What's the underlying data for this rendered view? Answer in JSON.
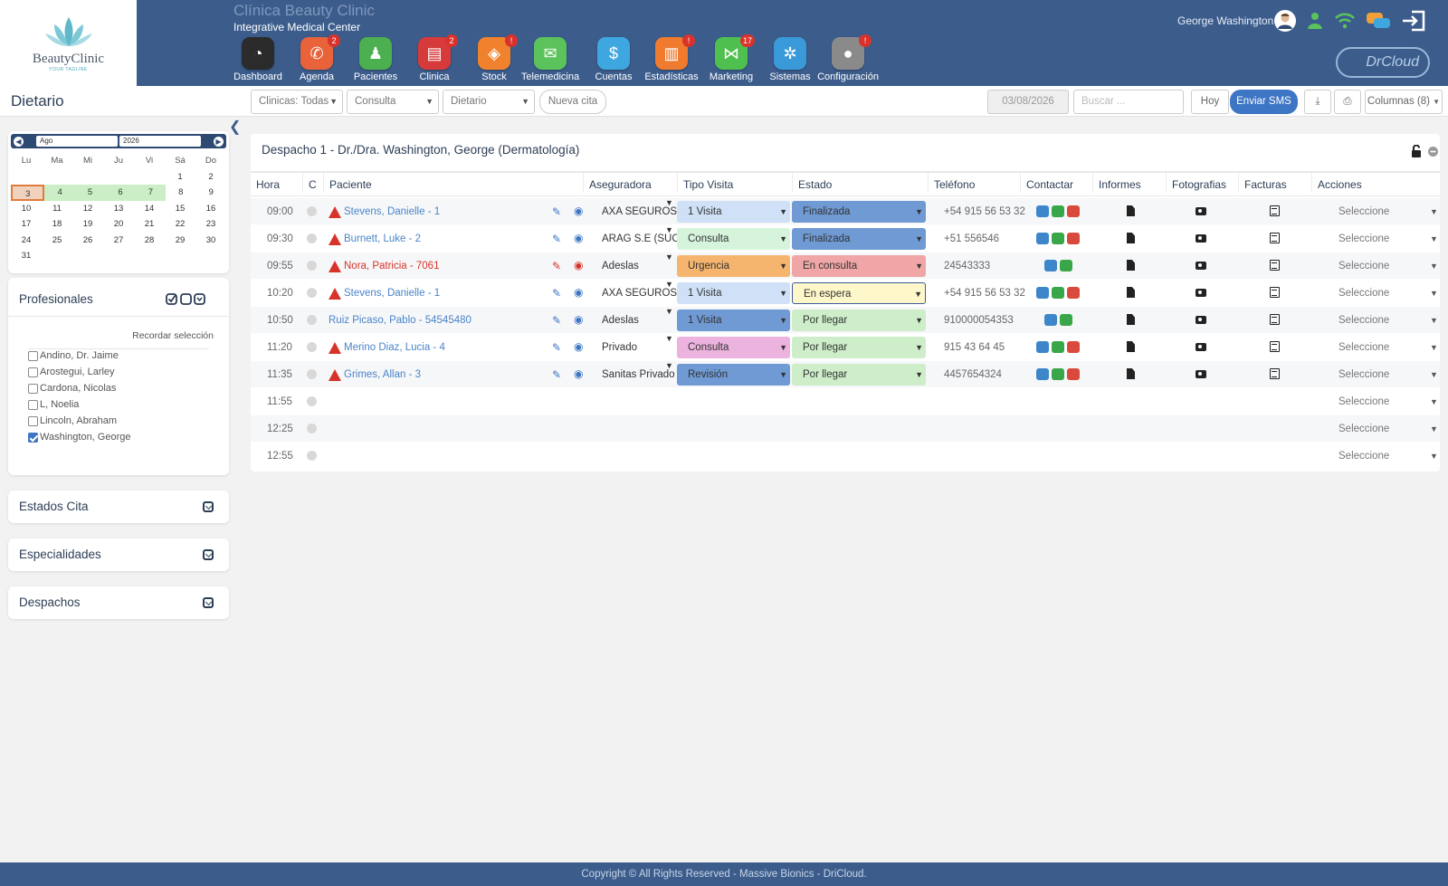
{
  "brand": {
    "logo_name": "BeautyClinic",
    "logo_tagline": "YOUR TAGLINE",
    "clinic_title": "Clínica Beauty Clinic",
    "clinic_subtitle": "Integrative Medical Center",
    "cloud_logo": "DrCloud"
  },
  "modules": [
    {
      "label": "Dashboard",
      "icon": "speedometer-icon",
      "color": "#2b2b2b",
      "badge": ""
    },
    {
      "label": "Agenda",
      "icon": "phone-icon",
      "color": "#e8623a",
      "badge": "2"
    },
    {
      "label": "Pacientes",
      "icon": "person-icon",
      "color": "#4caf50",
      "badge": ""
    },
    {
      "label": "Clinica",
      "icon": "clipboard-icon",
      "color": "#d63a3a",
      "badge": "2"
    },
    {
      "label": "Stock",
      "icon": "box-icon",
      "color": "#f0822e",
      "badge": "!"
    },
    {
      "label": "Telemedicina",
      "icon": "chat-icon",
      "color": "#5cc35c",
      "badge": ""
    },
    {
      "label": "Cuentas",
      "icon": "money-icon",
      "color": "#3fa7e0",
      "badge": ""
    },
    {
      "label": "Estadísticas",
      "icon": "chart-icon",
      "color": "#f07a2e",
      "badge": "!"
    },
    {
      "label": "Marketing",
      "icon": "share-icon",
      "color": "#4fbf4f",
      "badge": "17"
    },
    {
      "label": "Sistemas",
      "icon": "gear-icon",
      "color": "#3a9ad9",
      "badge": ""
    },
    {
      "label": "Configuración",
      "icon": "settings-icon",
      "color": "#8a8a8a",
      "badge": "!"
    }
  ],
  "user": {
    "name": "George Washington"
  },
  "toolbar": {
    "page_title": "Dietario",
    "clinicas": "Clinicas: Todas",
    "consulta": "Consulta",
    "dietario": "Dietario",
    "nueva_cita": "Nueva cita",
    "date_value": "03/08/2026",
    "search_placeholder": "Buscar ...",
    "hoy": "Hoy",
    "enviar_sms": "Enviar SMS",
    "columnas": "Columnas (8)"
  },
  "calendar": {
    "month": "Ago",
    "year": "2026",
    "weekdays": [
      "Lu",
      "Ma",
      "Mi",
      "Ju",
      "Vi",
      "Sá",
      "Do"
    ],
    "weeks": [
      [
        "",
        "",
        "",
        "",
        "",
        "1",
        "2"
      ],
      [
        "3",
        "4",
        "5",
        "6",
        "7",
        "8",
        "9"
      ],
      [
        "10",
        "11",
        "12",
        "13",
        "14",
        "15",
        "16"
      ],
      [
        "17",
        "18",
        "19",
        "20",
        "21",
        "22",
        "23"
      ],
      [
        "24",
        "25",
        "26",
        "27",
        "28",
        "29",
        "30"
      ],
      [
        "31",
        "",
        "",
        "",
        "",
        "",
        ""
      ]
    ],
    "today": "3",
    "highlighted": [
      "4",
      "5",
      "6",
      "7"
    ]
  },
  "profesionales": {
    "title": "Profesionales",
    "remember": "Recordar selección",
    "items": [
      {
        "label": "Andino, Dr. Jaime",
        "checked": false
      },
      {
        "label": "Arostegui, Larley",
        "checked": false
      },
      {
        "label": "Cardona, Nicolas",
        "checked": false
      },
      {
        "label": "L, Noelia",
        "checked": false
      },
      {
        "label": "Lincoln, Abraham",
        "checked": false
      },
      {
        "label": "Washington, George",
        "checked": true
      }
    ]
  },
  "panels": {
    "estados": "Estados Cita",
    "especialidades": "Especialidades",
    "despachos": "Despachos"
  },
  "agenda": {
    "title": "Despacho 1 - Dr./Dra. Washington, George (Dermatología)",
    "columns": [
      "Hora",
      "C",
      "Paciente",
      "Aseguradora",
      "Tipo Visita",
      "Estado",
      "Teléfono",
      "Contactar",
      "Informes",
      "Fotografias",
      "Facturas",
      "Acciones"
    ],
    "rows": [
      {
        "hora": "09:00",
        "paciente": "Stevens, Danielle - 1",
        "warn": true,
        "red": false,
        "aseguradora": "AXA SEGUROS G",
        "tipo": "1 Visita",
        "tipo_color": "#cfe0f7",
        "estado": "Finalizada",
        "estado_color": "#6f9ad4",
        "telefono": "+54 915 56 53 32",
        "email": true,
        "accion": "Seleccione"
      },
      {
        "hora": "09:30",
        "paciente": "Burnett, Luke - 2",
        "warn": true,
        "red": false,
        "aseguradora": "ARAG S.E (SUCU",
        "tipo": "Consulta",
        "tipo_color": "#d6f3dc",
        "estado": "Finalizada",
        "estado_color": "#6f9ad4",
        "telefono": "+51 556546",
        "email": true,
        "accion": "Seleccione"
      },
      {
        "hora": "09:55",
        "paciente": "Nora, Patricia - 7061",
        "warn": true,
        "red": true,
        "aseguradora": "Adeslas",
        "tipo": "Urgencia",
        "tipo_color": "#f5b56e",
        "estado": "En consulta",
        "estado_color": "#f0a6a6",
        "telefono": "24543333",
        "email": false,
        "accion": "Seleccione"
      },
      {
        "hora": "10:20",
        "paciente": "Stevens, Danielle - 1",
        "warn": true,
        "red": false,
        "aseguradora": "AXA SEGUROS G",
        "tipo": "1 Visita",
        "tipo_color": "#cfe0f7",
        "estado": "En espera",
        "estado_color": "#fdf7c9",
        "telefono": "+54 915 56 53 32",
        "email": true,
        "accion": "Seleccione"
      },
      {
        "hora": "10:50",
        "paciente": "Ruiz Picaso, Pablo - 54545480",
        "warn": false,
        "red": false,
        "aseguradora": "Adeslas",
        "tipo": "1 Visita",
        "tipo_color": "#6f9ad4",
        "estado": "Por llegar",
        "estado_color": "#cdeec9",
        "telefono": "910000054353",
        "email": false,
        "accion": "Seleccione"
      },
      {
        "hora": "11:20",
        "paciente": "Merino Diaz, Lucia - 4",
        "warn": true,
        "red": false,
        "aseguradora": "Privado",
        "tipo": "Consulta",
        "tipo_color": "#ecb3df",
        "estado": "Por llegar",
        "estado_color": "#cdeec9",
        "telefono": "915 43 64 45",
        "email": true,
        "accion": "Seleccione"
      },
      {
        "hora": "11:35",
        "paciente": "Grimes, Allan - 3",
        "warn": true,
        "red": false,
        "aseguradora": "Sanitas Privado",
        "tipo": "Revisión",
        "tipo_color": "#6f9ad4",
        "estado": "Por llegar",
        "estado_color": "#cdeec9",
        "telefono": "4457654324",
        "email": true,
        "accion": "Seleccione"
      },
      {
        "hora": "11:55",
        "paciente": "",
        "accion": "Seleccione"
      },
      {
        "hora": "12:25",
        "paciente": "",
        "accion": "Seleccione"
      },
      {
        "hora": "12:55",
        "paciente": "",
        "accion": "Seleccione"
      }
    ]
  },
  "footer": {
    "text": "Copyright © All Rights Reserved - Massive Bionics - DriCloud."
  }
}
